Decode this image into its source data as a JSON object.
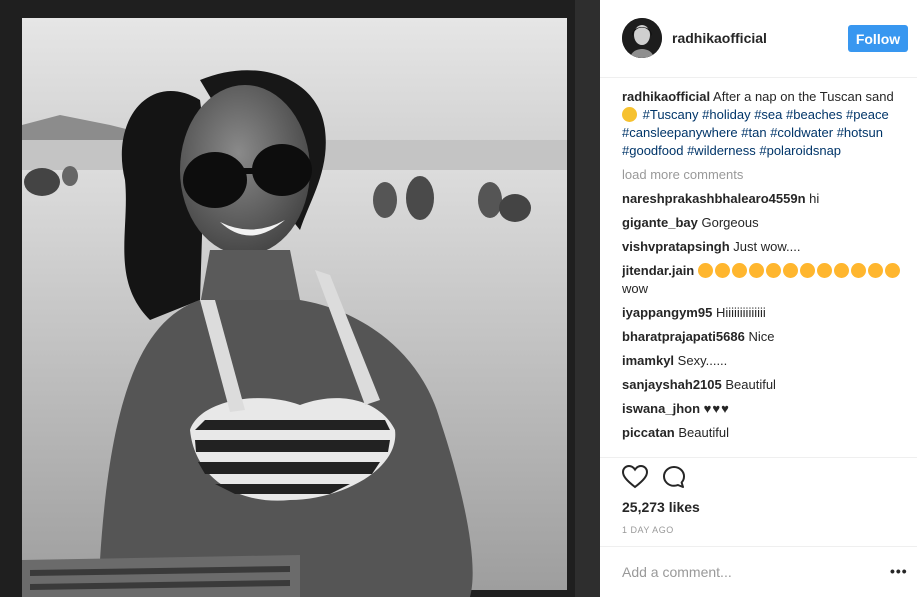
{
  "post": {
    "username": "radhikaofficial",
    "follow_label": "Follow",
    "caption": {
      "username": "radhikaofficial",
      "text": "After a nap on the Tuscan sand",
      "hashtags": [
        "#Tuscany",
        "#holiday",
        "#sea",
        "#beaches",
        "#peace",
        "#cansleepanywhere",
        "#tan",
        "#coldwater",
        "#hotsun",
        "#goodfood",
        "#wilderness",
        "#polaroidsnap"
      ]
    },
    "load_more": "load more comments",
    "comments": [
      {
        "user": "nareshprakashbhalearo4559n",
        "text": "hi"
      },
      {
        "user": "gigante_bay",
        "text": "Gorgeous"
      },
      {
        "user": "vishvpratapsingh",
        "text": "Just wow...."
      },
      {
        "user": "jitendar.jain",
        "text": "wow"
      },
      {
        "user": "iyappangym95",
        "text": "Hiiiiiiiiiiiiii"
      },
      {
        "user": "bharatprajapati5686",
        "text": "Nice"
      },
      {
        "user": "imamkyl",
        "text": "Sexy......"
      },
      {
        "user": "sanjayshah2105",
        "text": "Beautiful"
      },
      {
        "user": "iswana_jhon",
        "text": "♥♥♥"
      },
      {
        "user": "piccatan",
        "text": "Beautiful"
      }
    ],
    "likes": "25,273 likes",
    "timestamp": "1 DAY AGO",
    "add_comment_placeholder": "Add a comment...",
    "more_options": "•••"
  },
  "colors": {
    "follow_button": "#3897f0",
    "hashtag": "#003569",
    "muted": "#999999"
  }
}
